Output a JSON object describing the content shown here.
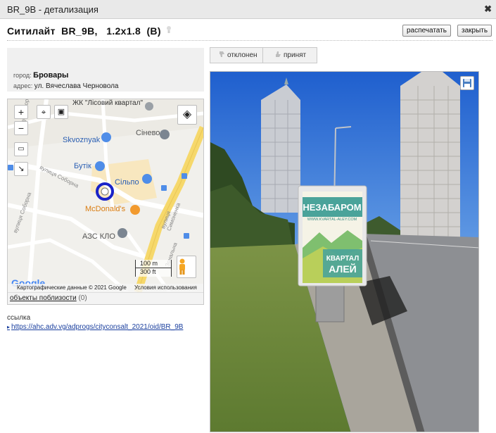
{
  "window": {
    "title": "BR_9B - детализация"
  },
  "header": {
    "title": "Ситилайт  BR_9B,   1.2x1.8  (B)",
    "print_label": "распечатать",
    "close_label": "закрыть"
  },
  "info": {
    "city_label": "город:",
    "city": "Бровары",
    "address_label": "адрес:",
    "address": "ул. Вячеслава Черновола"
  },
  "map": {
    "zoom_in": "+",
    "zoom_out": "−",
    "labels": {
      "lisovyi": "ЖК \"Лісовий квартал\"",
      "sineva": "Сінево",
      "skvoznyak": "Skvoznyak",
      "butik": "Бутік",
      "silpo": "Сільпо",
      "mcdonalds": "McDonald's",
      "azs": "АЗС КЛО",
      "street1": "вулиця Соборна",
      "street2": "вулиця Соборна",
      "street3": "вулиця Соборна",
      "street4": "вулиця Симоненка",
      "street5": "Зональна"
    },
    "scale_m": "100 m",
    "scale_ft": "300 ft",
    "google": "Google",
    "attribution": "Картографические данные © 2021 Google",
    "terms": "Условия использования",
    "nearby_label": "объекты поблизости",
    "nearby_count": "(0)"
  },
  "link": {
    "label": "ссылка",
    "url": "https://ahc.adv.vg/adprogs/cityconsalt_2021/oid/BR_9B"
  },
  "tabs": {
    "rejected": "отклонен",
    "accepted": "принят"
  },
  "photo": {
    "billboard_line1": "НЕЗАБАРОМ",
    "billboard_url": "WWW.KVARTAL-ALEY.COM",
    "billboard_line2": "КВАРТАЛ",
    "billboard_line3": "АЛЕЙ"
  },
  "colors": {
    "marker": "#1a23c8",
    "road_yellow": "#f6d86b",
    "sky": "#2e6fd6"
  }
}
